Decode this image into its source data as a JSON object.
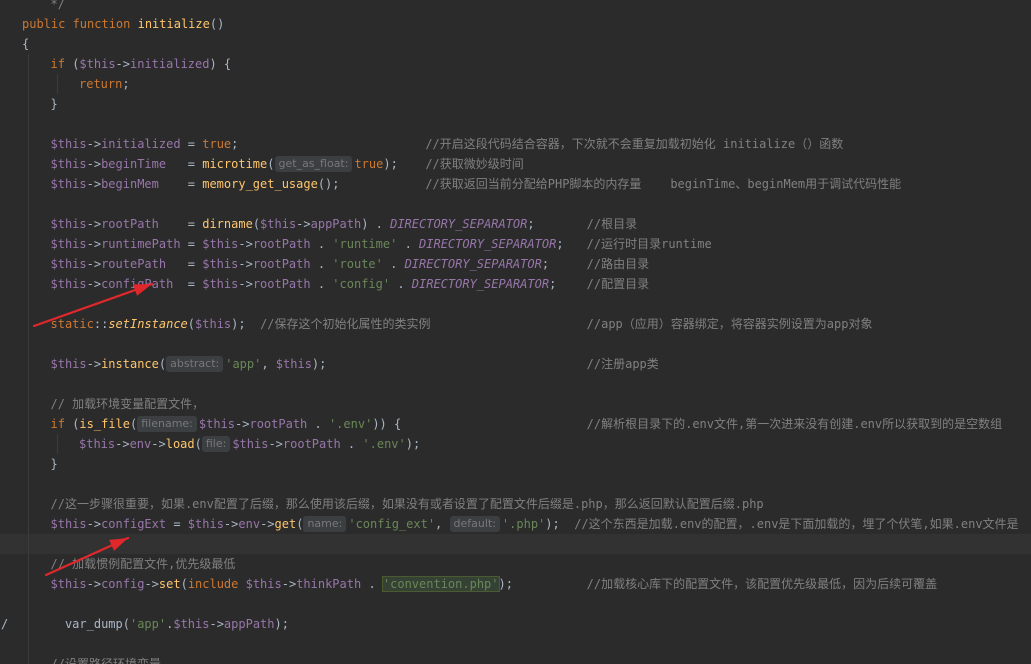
{
  "editor": {
    "colors": {
      "background": "#2b2b2b",
      "keyword": "#cc7832",
      "function": "#ffc66d",
      "variable": "#9876aa",
      "string": "#6a8759",
      "comment": "#808080",
      "text": "#a9b7c6",
      "annotation_arrow": "#e0282c"
    },
    "lines": [
      {
        "indent": 1,
        "tokens": [
          [
            "cmt",
            "*/"
          ]
        ]
      },
      {
        "indent": 0,
        "tokens": [
          [
            "kw",
            "public "
          ],
          [
            "kw",
            "function "
          ],
          [
            "fn",
            "initialize"
          ],
          [
            "txt",
            "()"
          ]
        ]
      },
      {
        "indent": 0,
        "tokens": [
          [
            "txt",
            "{"
          ]
        ]
      },
      {
        "indent": 1,
        "tokens": [
          [
            "kw",
            "if "
          ],
          [
            "txt",
            "("
          ],
          [
            "var",
            "$this"
          ],
          [
            "txt",
            "->"
          ],
          [
            "var",
            "initialized"
          ],
          [
            "txt",
            ") {"
          ]
        ]
      },
      {
        "indent": 2,
        "tokens": [
          [
            "kw",
            "return"
          ],
          [
            "txt",
            ";"
          ]
        ]
      },
      {
        "indent": 1,
        "tokens": [
          [
            "txt",
            "}"
          ]
        ]
      },
      {
        "indent": 1,
        "tokens": []
      },
      {
        "indent": 1,
        "tokens": [
          [
            "var",
            "$this"
          ],
          [
            "txt",
            "->"
          ],
          [
            "var",
            "initialized"
          ],
          [
            "txt",
            " = "
          ],
          [
            "kw",
            "true"
          ],
          [
            "txt",
            ";"
          ]
        ],
        "comment": "//开启这段代码结合容器，下次就不会重复加载初始化 initialize（）函数",
        "comment_col": 65
      },
      {
        "indent": 1,
        "tokens": [
          [
            "var",
            "$this"
          ],
          [
            "txt",
            "->"
          ],
          [
            "var",
            "beginTime"
          ],
          [
            "txt",
            "   = "
          ],
          [
            "fn",
            "microtime"
          ],
          [
            "txt",
            "("
          ],
          [
            "hint",
            "get_as_float:"
          ],
          [
            "kw",
            "true"
          ],
          [
            "txt",
            ");"
          ]
        ],
        "comment": "//获取微妙级时间",
        "comment_col": 65
      },
      {
        "indent": 1,
        "tokens": [
          [
            "var",
            "$this"
          ],
          [
            "txt",
            "->"
          ],
          [
            "var",
            "beginMem"
          ],
          [
            "txt",
            "    = "
          ],
          [
            "fn",
            "memory_get_usage"
          ],
          [
            "txt",
            "();"
          ]
        ],
        "comment": "//获取返回当前分配给PHP脚本的内存量    beginTime、beginMem用于调试代码性能",
        "comment_col": 65
      },
      {
        "indent": 1,
        "tokens": []
      },
      {
        "indent": 1,
        "tokens": [
          [
            "var",
            "$this"
          ],
          [
            "txt",
            "->"
          ],
          [
            "var",
            "rootPath"
          ],
          [
            "txt",
            "    = "
          ],
          [
            "fn",
            "dirname"
          ],
          [
            "txt",
            "("
          ],
          [
            "var",
            "$this"
          ],
          [
            "txt",
            "->"
          ],
          [
            "var",
            "appPath"
          ],
          [
            "txt",
            ") . "
          ],
          [
            "cst",
            "DIRECTORY_SEPARATOR"
          ],
          [
            "txt",
            ";"
          ]
        ],
        "comment": "//根目录",
        "comment_col": 91
      },
      {
        "indent": 1,
        "tokens": [
          [
            "var",
            "$this"
          ],
          [
            "txt",
            "->"
          ],
          [
            "var",
            "runtimePath"
          ],
          [
            "txt",
            " = "
          ],
          [
            "var",
            "$this"
          ],
          [
            "txt",
            "->"
          ],
          [
            "var",
            "rootPath"
          ],
          [
            "txt",
            " . "
          ],
          [
            "str",
            "'runtime'"
          ],
          [
            "txt",
            " . "
          ],
          [
            "cst",
            "DIRECTORY_SEPARATOR"
          ],
          [
            "txt",
            ";"
          ]
        ],
        "comment": "//运行时目录runtime",
        "comment_col": 91
      },
      {
        "indent": 1,
        "tokens": [
          [
            "var",
            "$this"
          ],
          [
            "txt",
            "->"
          ],
          [
            "var",
            "routePath"
          ],
          [
            "txt",
            "   = "
          ],
          [
            "var",
            "$this"
          ],
          [
            "txt",
            "->"
          ],
          [
            "var",
            "rootPath"
          ],
          [
            "txt",
            " . "
          ],
          [
            "str",
            "'route'"
          ],
          [
            "txt",
            " . "
          ],
          [
            "cst",
            "DIRECTORY_SEPARATOR"
          ],
          [
            "txt",
            ";"
          ]
        ],
        "comment": "//路由目录",
        "comment_col": 91
      },
      {
        "indent": 1,
        "tokens": [
          [
            "var",
            "$this"
          ],
          [
            "txt",
            "->"
          ],
          [
            "var",
            "configPath"
          ],
          [
            "txt",
            "  = "
          ],
          [
            "var",
            "$this"
          ],
          [
            "txt",
            "->"
          ],
          [
            "var",
            "rootPath"
          ],
          [
            "txt",
            " . "
          ],
          [
            "str",
            "'config'"
          ],
          [
            "txt",
            " . "
          ],
          [
            "cst",
            "DIRECTORY_SEPARATOR"
          ],
          [
            "txt",
            ";"
          ]
        ],
        "comment": "//配置目录",
        "comment_col": 91
      },
      {
        "indent": 1,
        "tokens": []
      },
      {
        "indent": 1,
        "tokens": [
          [
            "kw",
            "static"
          ],
          [
            "txt",
            "::"
          ],
          [
            "sfn",
            "setInstance"
          ],
          [
            "txt",
            "("
          ],
          [
            "var",
            "$this"
          ],
          [
            "txt",
            ");  "
          ],
          [
            "cmt",
            "//保存这个初始化属性的类实例"
          ]
        ],
        "comment": "//app（应用）容器绑定，将容器实例设置为app对象",
        "comment_col": 91
      },
      {
        "indent": 1,
        "tokens": []
      },
      {
        "indent": 1,
        "tokens": [
          [
            "var",
            "$this"
          ],
          [
            "txt",
            "->"
          ],
          [
            "fn",
            "instance"
          ],
          [
            "txt",
            "("
          ],
          [
            "hint",
            "abstract:"
          ],
          [
            "str",
            "'app'"
          ],
          [
            "txt",
            ", "
          ],
          [
            "var",
            "$this"
          ],
          [
            "txt",
            ");"
          ]
        ],
        "comment": "//注册app类",
        "comment_col": 91
      },
      {
        "indent": 1,
        "tokens": []
      },
      {
        "indent": 1,
        "tokens": [
          [
            "cmt",
            "// 加载环境变量配置文件，"
          ]
        ]
      },
      {
        "indent": 1,
        "tokens": [
          [
            "kw",
            "if "
          ],
          [
            "txt",
            "("
          ],
          [
            "fn",
            "is_file"
          ],
          [
            "txt",
            "("
          ],
          [
            "hint",
            "filename:"
          ],
          [
            "var",
            "$this"
          ],
          [
            "txt",
            "->"
          ],
          [
            "var",
            "rootPath"
          ],
          [
            "txt",
            " . "
          ],
          [
            "str",
            "'.env'"
          ],
          [
            "txt",
            ")) {"
          ]
        ],
        "comment": "//解析根目录下的.env文件,第一次进来没有创建.env所以获取到的是空数组",
        "comment_col": 91
      },
      {
        "indent": 2,
        "tokens": [
          [
            "var",
            "$this"
          ],
          [
            "txt",
            "->"
          ],
          [
            "var",
            "env"
          ],
          [
            "txt",
            "->"
          ],
          [
            "fn",
            "load"
          ],
          [
            "txt",
            "("
          ],
          [
            "hint",
            "file:"
          ],
          [
            "var",
            "$this"
          ],
          [
            "txt",
            "->"
          ],
          [
            "var",
            "rootPath"
          ],
          [
            "txt",
            " . "
          ],
          [
            "str",
            "'.env'"
          ],
          [
            "txt",
            ");"
          ]
        ]
      },
      {
        "indent": 1,
        "tokens": [
          [
            "txt",
            "}"
          ]
        ]
      },
      {
        "indent": 1,
        "tokens": []
      },
      {
        "indent": 1,
        "tokens": [
          [
            "cmt",
            "//这一步骤很重要，如果.env配置了后缀，那么使用该后缀，如果没有或者设置了配置文件后缀是.php，那么返回默认配置后缀.php"
          ]
        ]
      },
      {
        "indent": 1,
        "tokens": [
          [
            "var",
            "$this"
          ],
          [
            "txt",
            "->"
          ],
          [
            "var",
            "configExt"
          ],
          [
            "txt",
            " = "
          ],
          [
            "var",
            "$this"
          ],
          [
            "txt",
            "->"
          ],
          [
            "var",
            "env"
          ],
          [
            "txt",
            "->"
          ],
          [
            "fn",
            "get"
          ],
          [
            "txt",
            "("
          ],
          [
            "hint",
            "name:"
          ],
          [
            "str",
            "'config_ext'"
          ],
          [
            "txt",
            ", "
          ],
          [
            "hint",
            "default:"
          ],
          [
            "str",
            "'.php'"
          ],
          [
            "txt",
            ");  "
          ],
          [
            "cmt",
            "//这个东西是加载.env的配置，.env是下面加载的，埋了个伏笔,如果.env文件是"
          ]
        ]
      },
      {
        "indent": 1,
        "tokens": [],
        "current": true
      },
      {
        "indent": 1,
        "tokens": [
          [
            "cmt",
            "// 加载惯例配置文件,优先级最低"
          ]
        ]
      },
      {
        "indent": 1,
        "tokens": [
          [
            "var",
            "$this"
          ],
          [
            "txt",
            "->"
          ],
          [
            "var",
            "config"
          ],
          [
            "txt",
            "->"
          ],
          [
            "fn",
            "set"
          ],
          [
            "txt",
            "("
          ],
          [
            "kw",
            "include "
          ],
          [
            "var",
            "$this"
          ],
          [
            "txt",
            "->"
          ],
          [
            "var",
            "thinkPath"
          ],
          [
            "txt",
            " . "
          ],
          [
            "boxstr",
            "'convention.php'"
          ],
          [
            "txt",
            ");"
          ]
        ],
        "comment": "//加载核心库下的配置文件，该配置优先级最低，因为后续可覆盖",
        "comment_col": 91
      },
      {
        "indent": 1,
        "tokens": []
      },
      {
        "indent": 1,
        "tokens": [
          [
            "txt",
            "  var_dump("
          ],
          [
            "str",
            "'app'"
          ],
          [
            "txt",
            "."
          ],
          [
            "var",
            "$this"
          ],
          [
            "txt",
            "->"
          ],
          [
            "var",
            "appPath"
          ],
          [
            "txt",
            ");"
          ]
        ],
        "gutter": "/"
      },
      {
        "indent": 1,
        "tokens": []
      },
      {
        "indent": 1,
        "tokens": [
          [
            "cmt",
            "//设置路径环境变量"
          ]
        ]
      }
    ]
  }
}
